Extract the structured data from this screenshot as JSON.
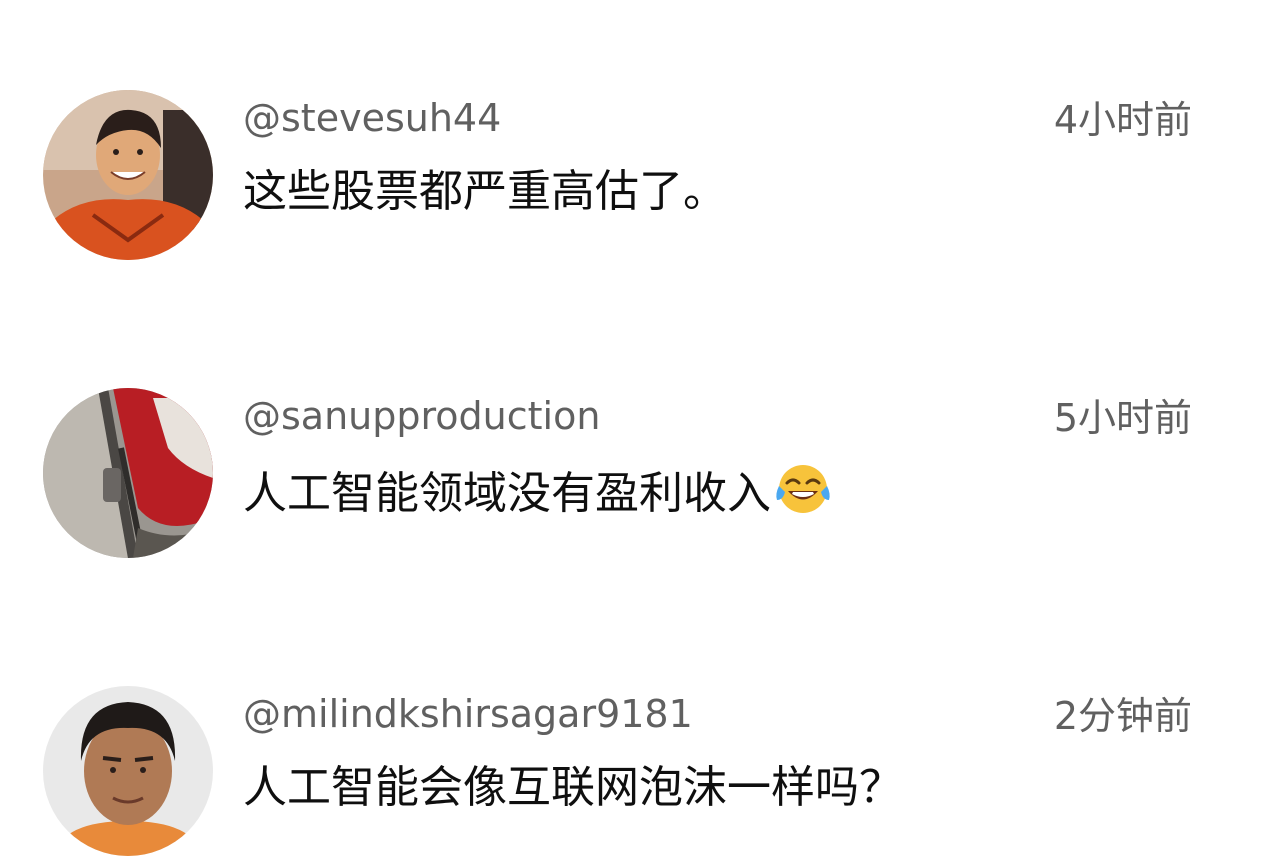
{
  "comments": [
    {
      "handle": "@stevesuh44",
      "time": "4小时前",
      "text": "这些股票都严重高估了。"
    },
    {
      "handle": "@sanupproduction",
      "time": "5小时前",
      "text": "人工智能领域没有盈利收入",
      "emoji": "face-with-tears-of-joy-icon"
    },
    {
      "handle": "@milindkshirsagar9181",
      "time": "2分钟前",
      "text": "人工智能会像互联网泡沫一样吗？"
    }
  ]
}
